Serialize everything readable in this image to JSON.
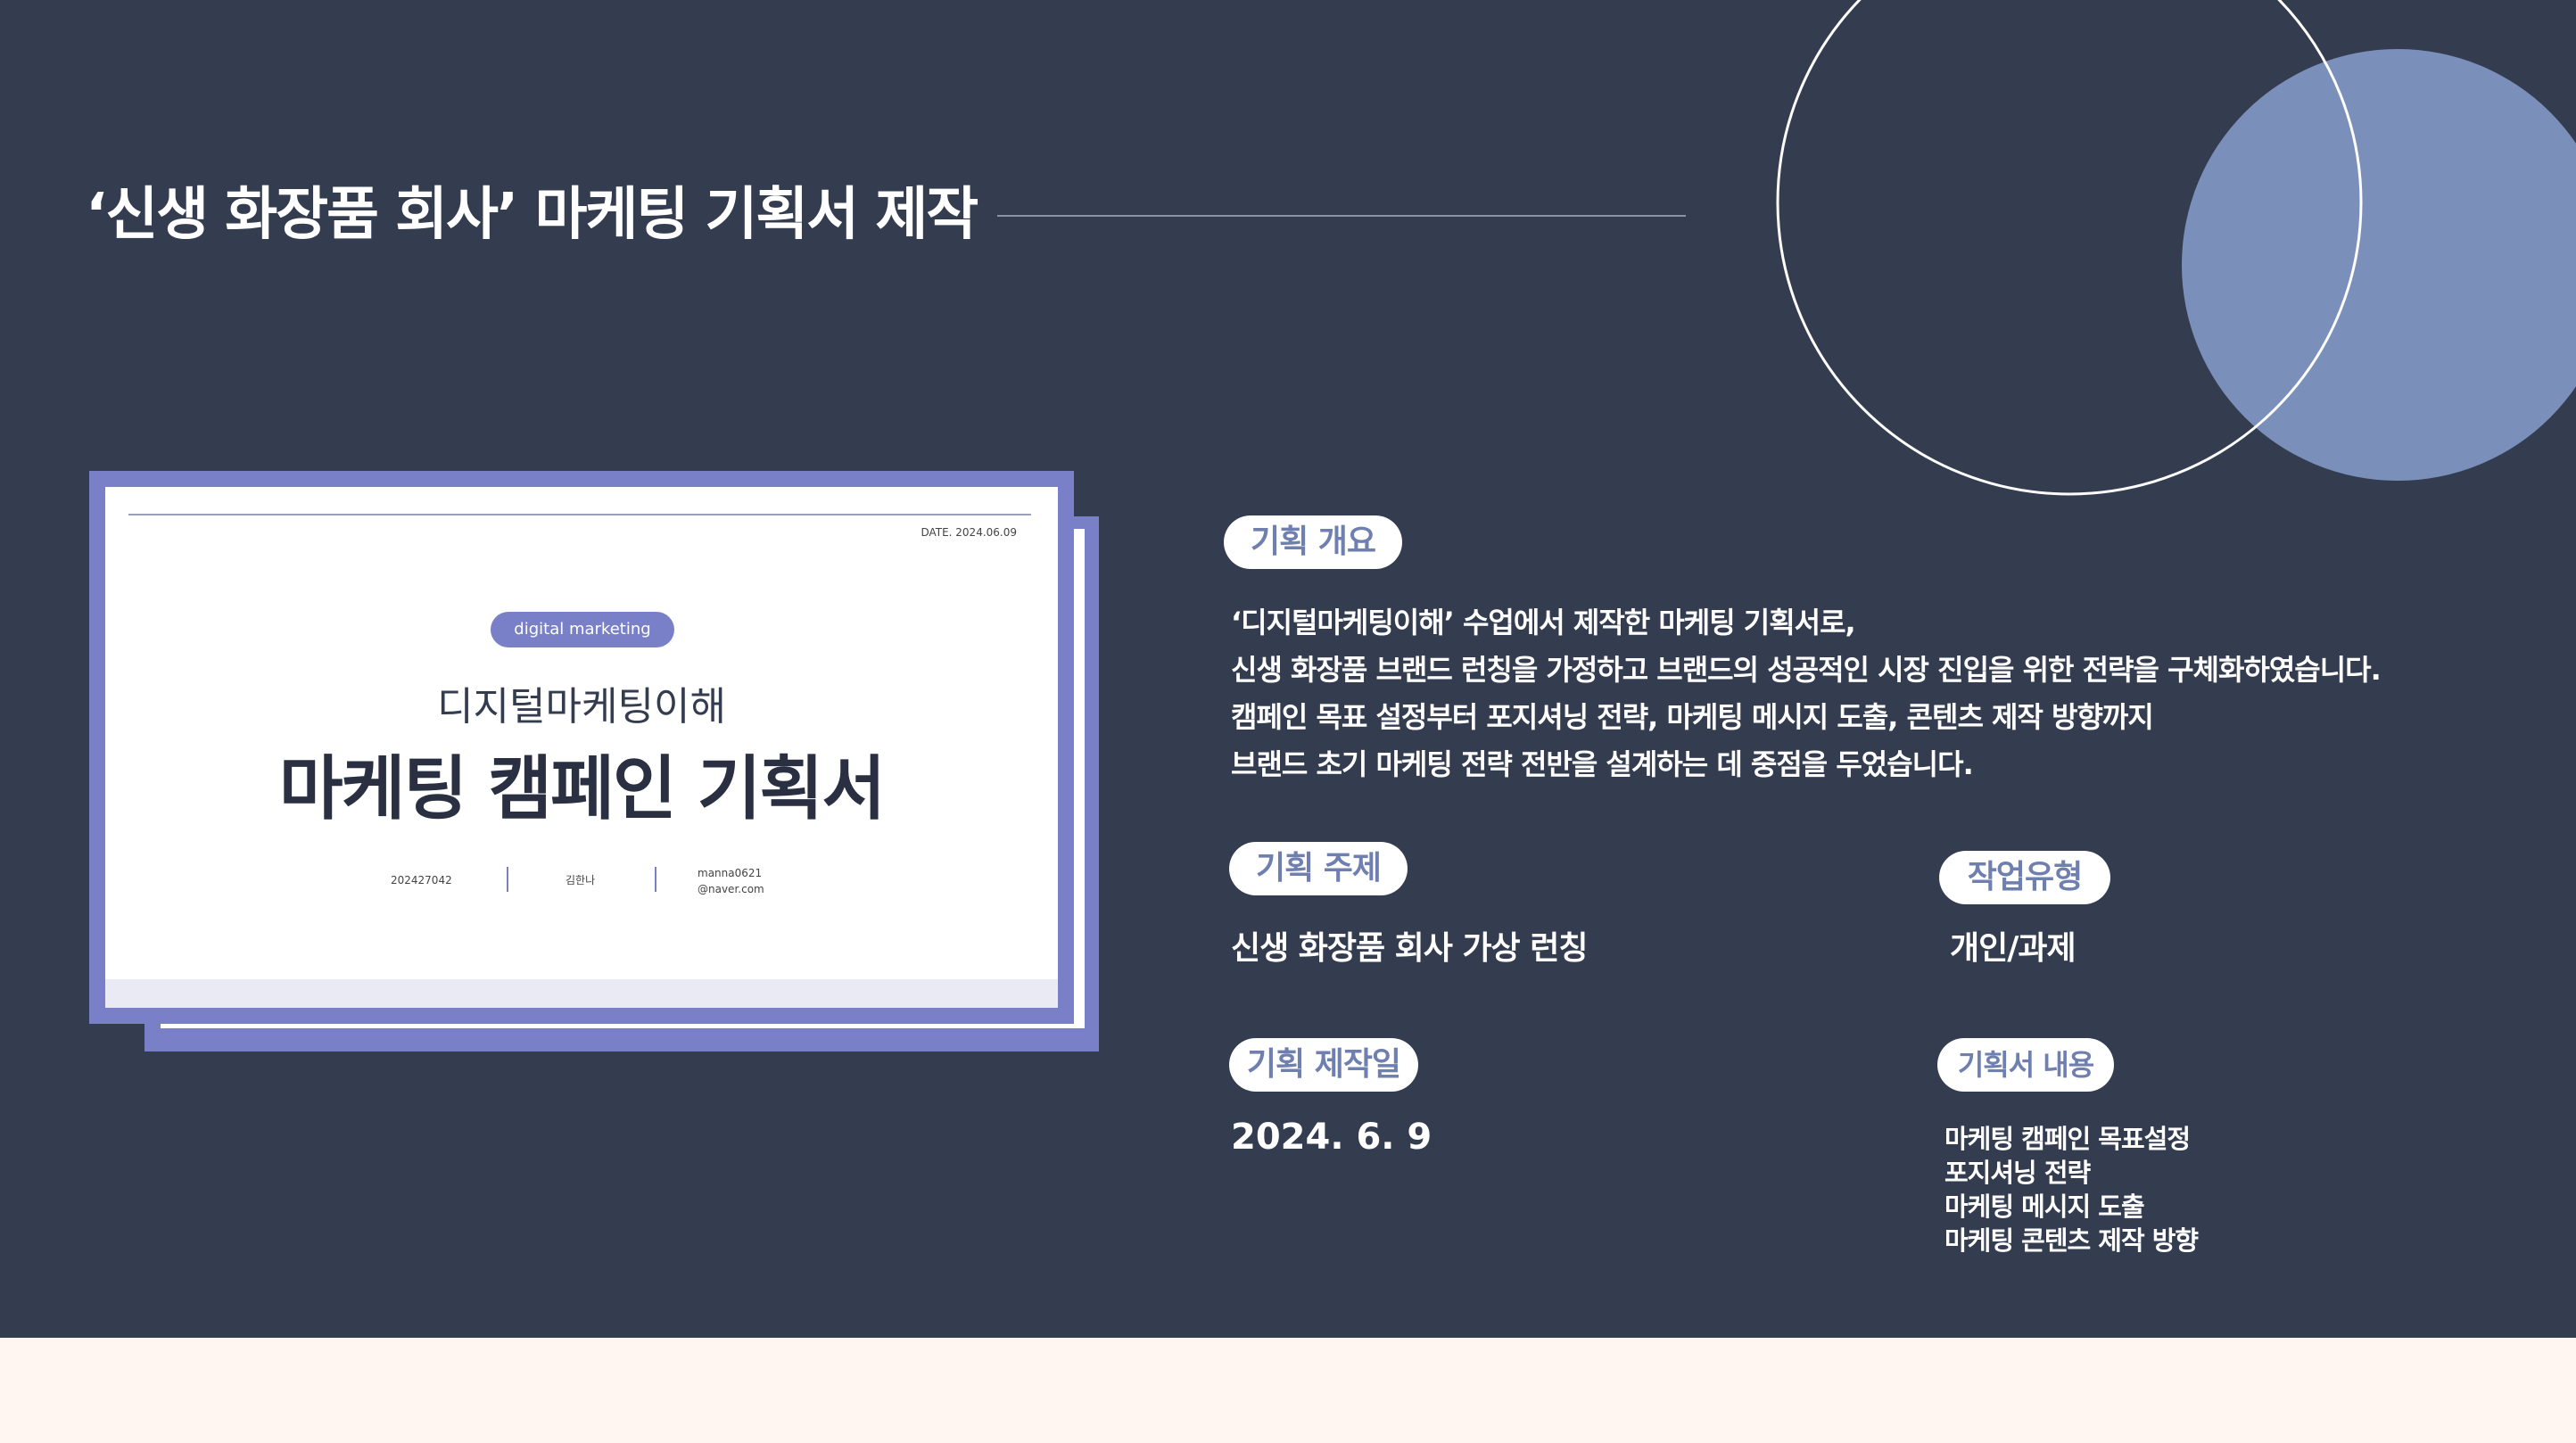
{
  "slide": {
    "title": "‘신생 화장품 회사’ 마케팅 기획서 제작"
  },
  "preview": {
    "date": "DATE. 2024.06.09",
    "tag": "digital marketing",
    "subtitle": "디지털마케팅이해",
    "title": "마케팅 캠페인 기획서",
    "student_id": "202427042",
    "name": "김한나",
    "email": "manna0621\n@naver.com"
  },
  "overview": {
    "label": "기획 개요",
    "lines": [
      "‘디지털마케팅이해’ 수업에서 제작한 마케팅 기획서로,",
      "신생 화장품 브랜드 런칭을 가정하고 브랜드의 성공적인 시장 진입을 위한 전략을 구체화하였습니다.",
      "캠페인 목표 설정부터 포지셔닝 전략, 마케팅 메시지 도출, 콘텐츠 제작 방향까지",
      "브랜드 초기 마케팅 전략 전반을 설계하는 데 중점을 두었습니다."
    ]
  },
  "topic": {
    "label": "기획 주제",
    "value": "신생 화장품 회사 가상 런칭"
  },
  "work_type": {
    "label": "작업유형",
    "value": "개인/과제"
  },
  "date": {
    "label": "기획 제작일",
    "value": "2024. 6. 9"
  },
  "contents": {
    "label": "기획서 내용",
    "items": [
      "마케팅 캠페인 목표설정",
      "포지셔닝 전략",
      "마케팅 메시지 도출",
      "마케팅 콘텐츠 제작 방향"
    ]
  },
  "colors": {
    "background": "#343c50",
    "accent": "#7a80c8",
    "pill_text": "#6e7fb0",
    "band": "#fff5f1"
  }
}
